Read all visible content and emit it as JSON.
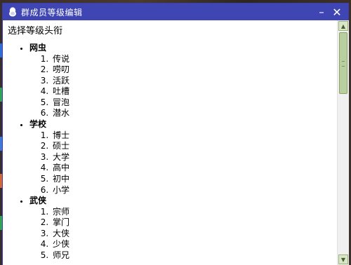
{
  "window": {
    "title": "群成员等级编辑",
    "icon": "qq-penguin-icon"
  },
  "controls": {
    "minimize": "–",
    "close": "✕"
  },
  "content": {
    "heading": "选择等级头衔",
    "groups": [
      {
        "name": "网虫",
        "titles": [
          "传说",
          "唠叨",
          "活跃",
          "吐槽",
          "冒泡",
          "潜水"
        ]
      },
      {
        "name": "学校",
        "titles": [
          "博士",
          "硕士",
          "大学",
          "高中",
          "初中",
          "小学"
        ]
      },
      {
        "name": "武侠",
        "titles": [
          "宗师",
          "掌门",
          "大侠",
          "少侠",
          "师兄"
        ]
      }
    ]
  },
  "scrollbar": {
    "up": "▲",
    "down": "▼"
  }
}
